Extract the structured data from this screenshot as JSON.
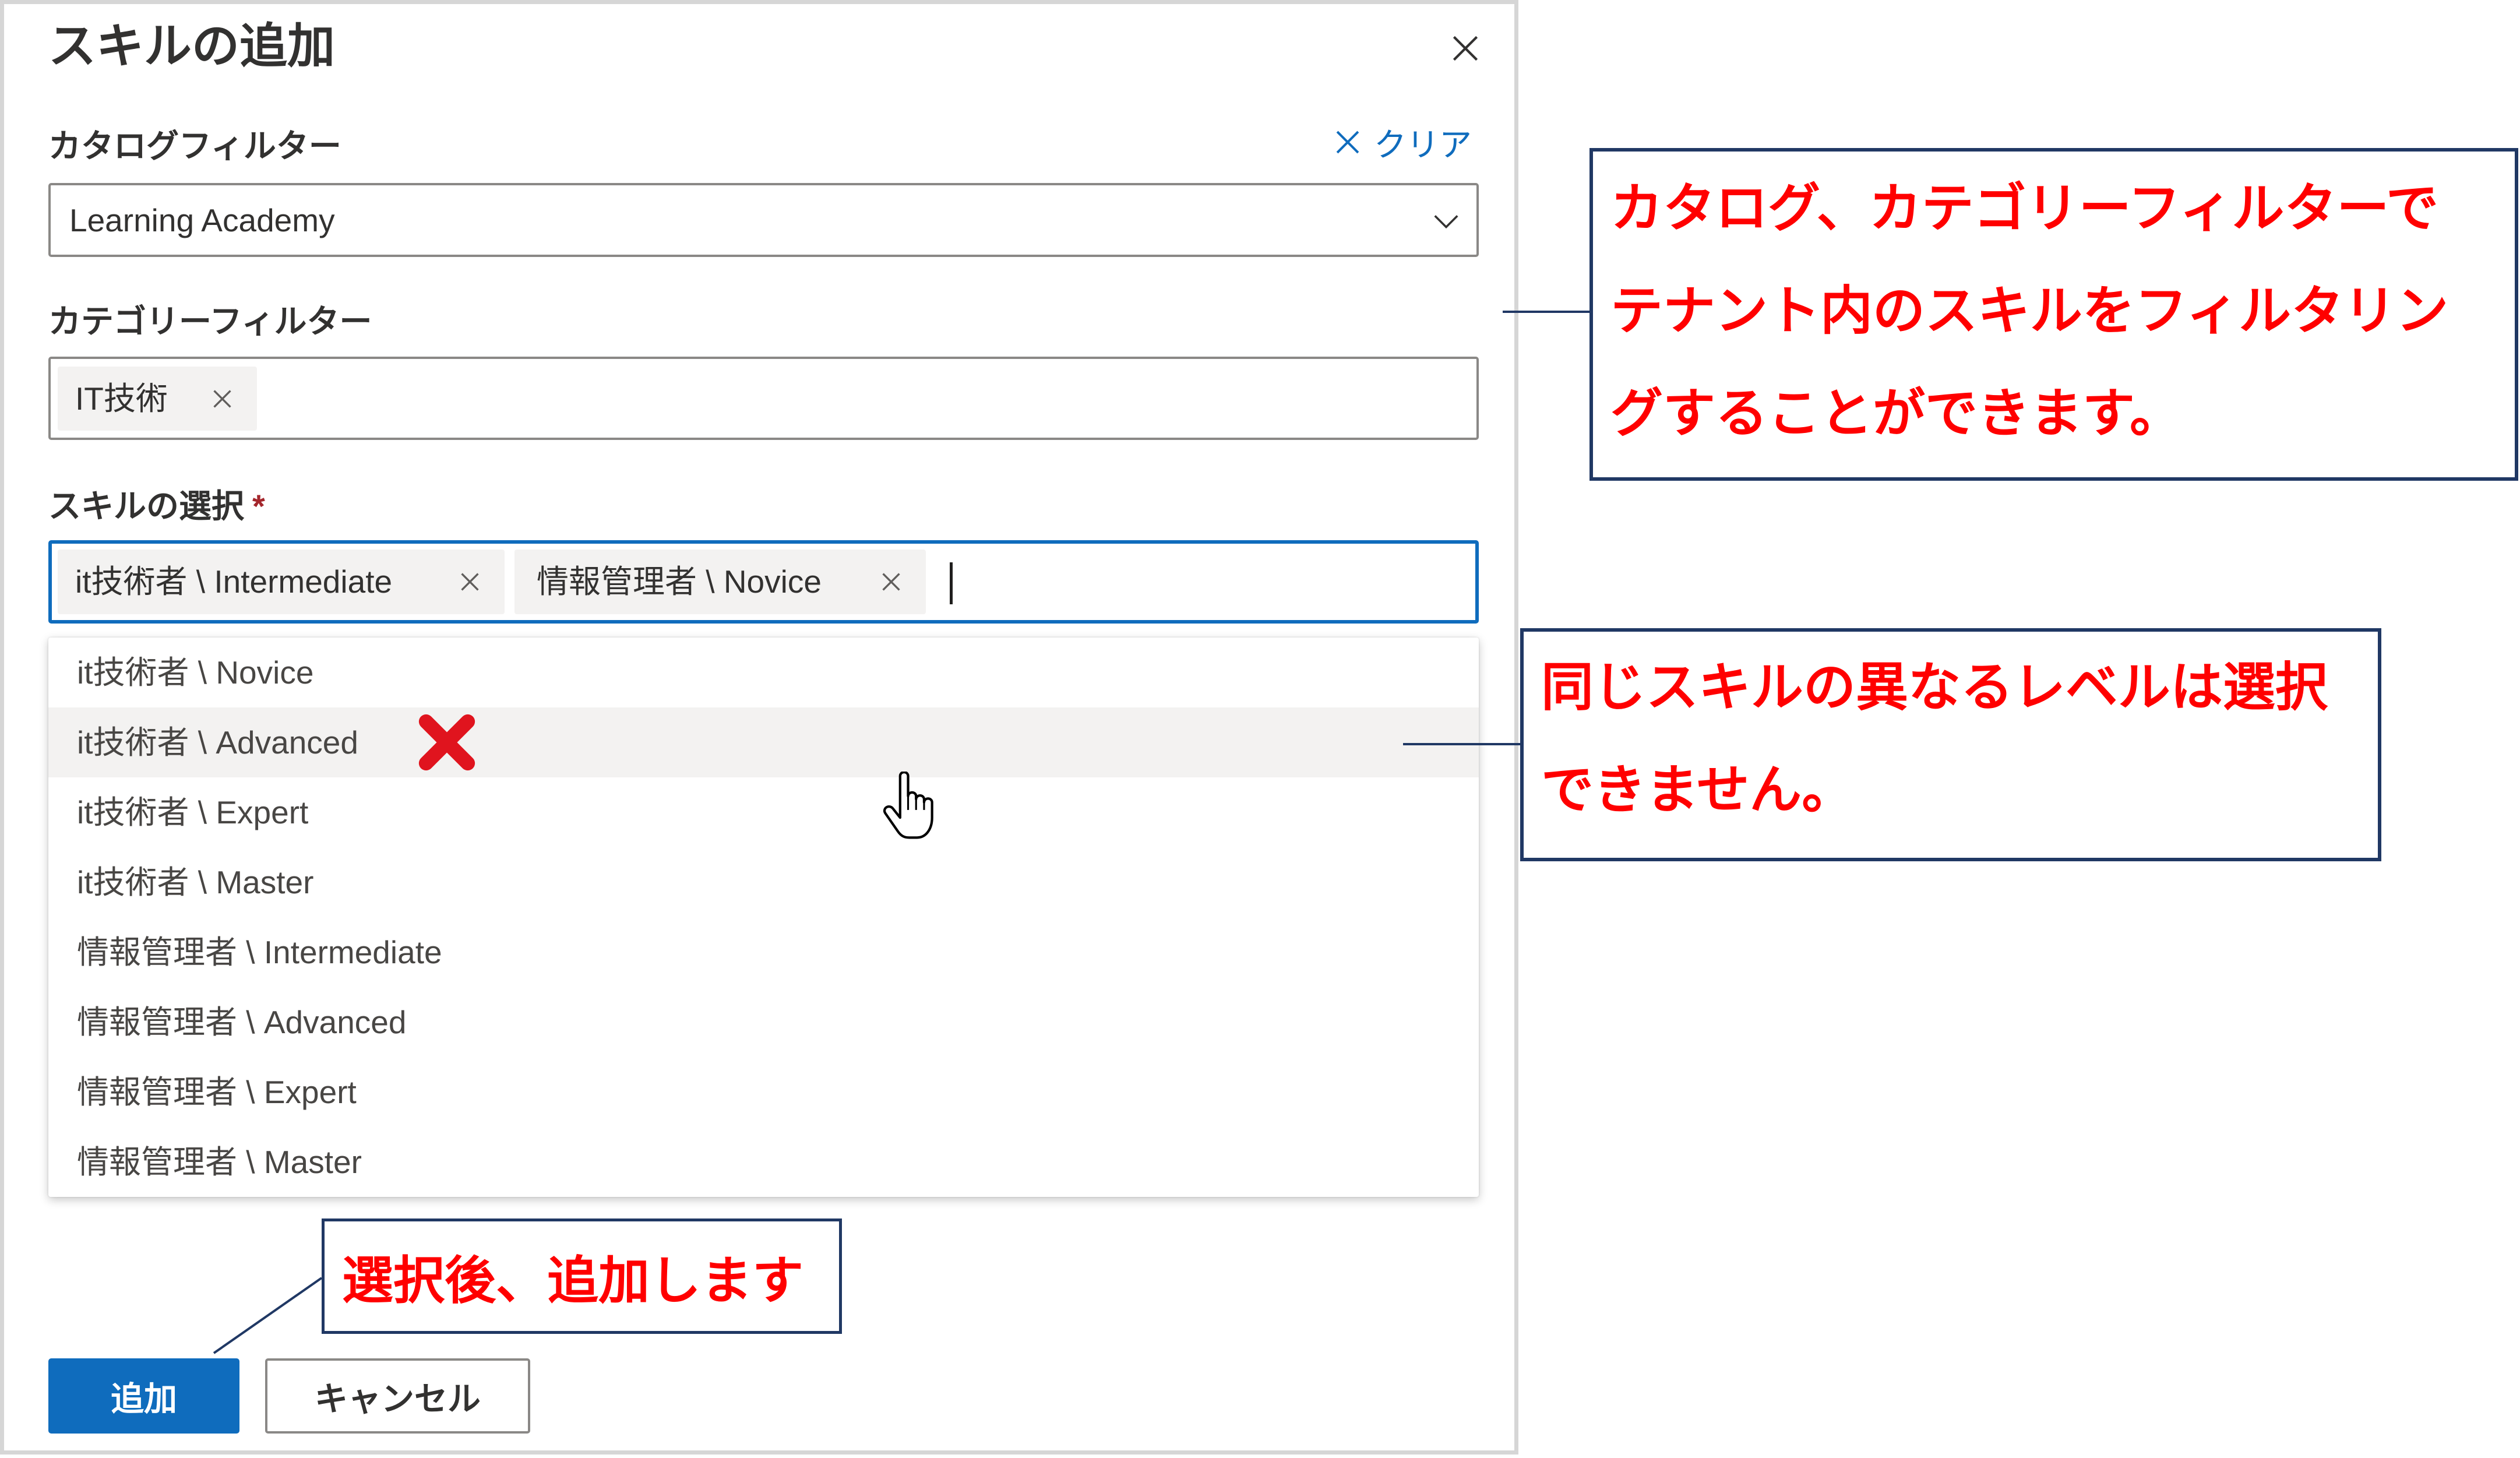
{
  "dialog": {
    "title": "スキルの追加",
    "close_icon": "close-icon",
    "catalog_filter": {
      "label": "カタログフィルター",
      "clear_icon": "x-icon",
      "clear_label": "クリア",
      "value": "Learning Academy",
      "dropdown_icon": "chevron-down-icon"
    },
    "category_filter": {
      "label": "カテゴリーフィルター",
      "tags": [
        {
          "label": "IT技術",
          "remove_icon": "close-icon"
        }
      ]
    },
    "skill_select": {
      "label": "スキルの選択",
      "required_marker": "*",
      "selected": [
        {
          "label": "it技術者 \\ Intermediate",
          "remove_icon": "close-icon"
        },
        {
          "label": "情報管理者 \\ Novice",
          "remove_icon": "close-icon"
        }
      ],
      "options": [
        {
          "label": "it技術者 \\ Novice",
          "highlighted": false
        },
        {
          "label": "it技術者 \\ Advanced",
          "highlighted": true
        },
        {
          "label": "it技術者 \\ Expert",
          "highlighted": false
        },
        {
          "label": "it技術者 \\ Master",
          "highlighted": false
        },
        {
          "label": "情報管理者 \\ Intermediate",
          "highlighted": false
        },
        {
          "label": "情報管理者 \\ Advanced",
          "highlighted": false
        },
        {
          "label": "情報管理者 \\ Expert",
          "highlighted": false
        },
        {
          "label": "情報管理者 \\ Master",
          "highlighted": false
        }
      ]
    },
    "buttons": {
      "add": "追加",
      "cancel": "キャンセル"
    }
  },
  "annotations": {
    "filter_callout": {
      "lines": [
        "カタログ、カテゴリーフィルターで",
        "テナント内のスキルをフィルタリン",
        "グすることができます。"
      ]
    },
    "level_callout": {
      "lines": [
        "同じスキルの異なるレベルは選択",
        "できません。"
      ]
    },
    "add_callout": {
      "text": "選択後、追加します"
    },
    "not_selectable_marker_icon": "red-x-mark-icon",
    "pointer_icon": "hand-pointer-icon"
  },
  "colors": {
    "primary": "#0f6cbd",
    "focus_border": "#0f6cbd",
    "required": "#a4262c",
    "annotation_text": "#ff0000",
    "annotation_border": "#203864",
    "marker": "#e0141e",
    "highlight_row": "#f3f2f1",
    "chip": "#f3f2f1",
    "input_border": "#8a8886"
  }
}
